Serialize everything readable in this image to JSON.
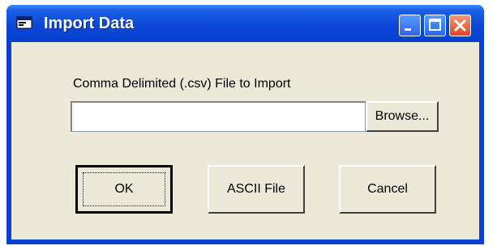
{
  "window": {
    "title": "Import Data",
    "icons": {
      "app": "app-window-icon",
      "minimize": "minimize-icon",
      "maximize": "maximize-icon",
      "close": "close-icon"
    }
  },
  "form": {
    "file_label": "Comma Delimited (.csv) File to Import",
    "file_value": "",
    "browse_label": "Browse..."
  },
  "buttons": {
    "ok_label": "OK",
    "ascii_label": "ASCII File",
    "cancel_label": "Cancel"
  },
  "colors": {
    "titlebar": "#0a3fd0",
    "client_background": "#ece9d8",
    "close_button": "#d8481f"
  }
}
